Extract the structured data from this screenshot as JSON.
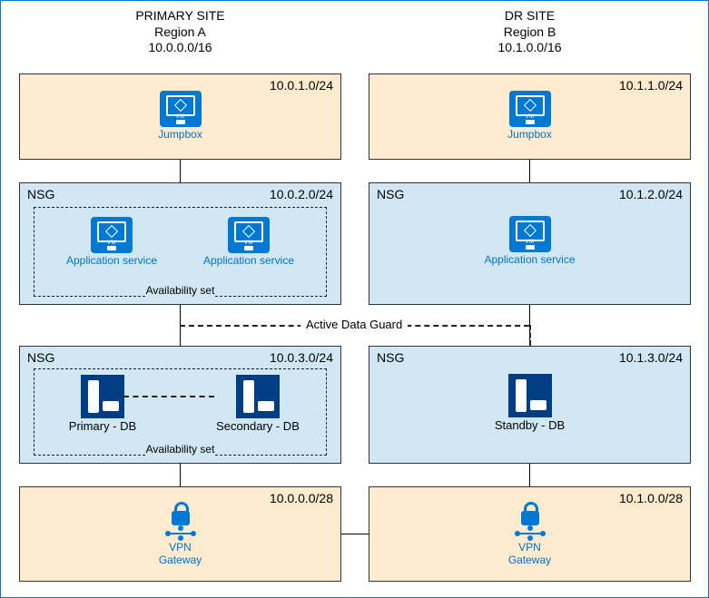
{
  "primary": {
    "title": "PRIMARY SITE",
    "region": "Region A",
    "cidr": "10.0.0.0/16",
    "jump": {
      "cidr": "10.0.1.0/24",
      "label": "Jumpbox"
    },
    "app": {
      "nsg": "NSG",
      "cidr": "10.0.2.0/24",
      "avset": "Availability set",
      "svc1": "Application service",
      "svc2": "Application service"
    },
    "db": {
      "nsg": "NSG",
      "cidr": "10.0.3.0/24",
      "avset": "Availability set",
      "db1": "Primary - DB",
      "db2": "Secondary - DB"
    },
    "vpn": {
      "cidr": "10.0.0.0/28",
      "l1": "VPN",
      "l2": "Gateway"
    }
  },
  "dr": {
    "title": "DR SITE",
    "region": "Region B",
    "cidr": "10.1.0.0/16",
    "jump": {
      "cidr": "10.1.1.0/24",
      "label": "Jumpbox"
    },
    "app": {
      "nsg": "NSG",
      "cidr": "10.1.2.0/24",
      "svc": "Application service"
    },
    "db": {
      "nsg": "NSG",
      "cidr": "10.1.3.0/24",
      "db": "Standby - DB"
    },
    "vpn": {
      "cidr": "10.1.0.0/28",
      "l1": "VPN",
      "l2": "Gateway"
    }
  },
  "links": {
    "adg": "Active Data Guard"
  },
  "vm_tag": "VM"
}
